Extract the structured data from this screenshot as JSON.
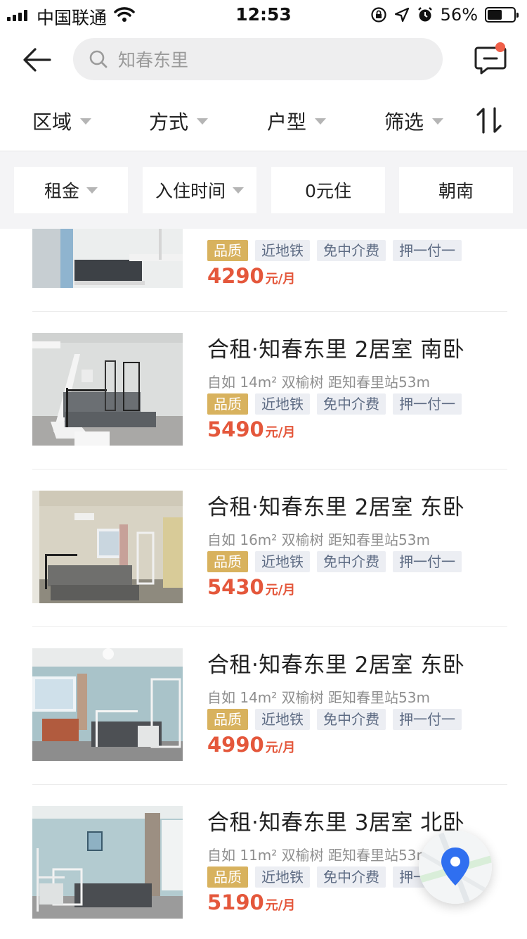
{
  "status_bar": {
    "carrier": "中国联通",
    "time": "12:53",
    "battery_percent": "56%",
    "battery_level": 0.56
  },
  "nav": {
    "search_placeholder": "知春东里",
    "has_unread_message": true
  },
  "filters": [
    {
      "label": "区域"
    },
    {
      "label": "方式"
    },
    {
      "label": "户型"
    },
    {
      "label": "筛选"
    }
  ],
  "quick_filters": [
    {
      "label": "租金",
      "has_dropdown": true
    },
    {
      "label": "入住时间",
      "has_dropdown": true
    },
    {
      "label": "0元住",
      "has_dropdown": false
    },
    {
      "label": "朝南",
      "has_dropdown": false
    }
  ],
  "listings": [
    {
      "title": "",
      "meta": "",
      "tags": [
        "品质",
        "近地铁",
        "免中介费",
        "押一付一"
      ],
      "price": "4290",
      "price_unit": "元/月"
    },
    {
      "title": "合租·知春东里 2居室 南卧",
      "meta": "自如   14m² 双榆树 距知春里站53m",
      "tags": [
        "品质",
        "近地铁",
        "免中介费",
        "押一付一"
      ],
      "price": "5490",
      "price_unit": "元/月"
    },
    {
      "title": "合租·知春东里 2居室 东卧",
      "meta": "自如   16m² 双榆树 距知春里站53m",
      "tags": [
        "品质",
        "近地铁",
        "免中介费",
        "押一付一"
      ],
      "price": "5430",
      "price_unit": "元/月"
    },
    {
      "title": "合租·知春东里 2居室 东卧",
      "meta": "自如   14m² 双榆树 距知春里站53m",
      "tags": [
        "品质",
        "近地铁",
        "免中介费",
        "押一付一"
      ],
      "price": "4990",
      "price_unit": "元/月"
    },
    {
      "title": "合租·知春东里 3居室 北卧",
      "meta": "自如   11m² 双榆树 距知春里站53m",
      "tags": [
        "品质",
        "近地铁",
        "免中介费",
        "押一付一"
      ],
      "price": "5190",
      "price_unit": "元/月"
    }
  ],
  "colors": {
    "price": "#e4573b",
    "quality_tag": "#d8b25e",
    "tag_bg": "#eceef3",
    "map_pin": "#2f6ff0",
    "notify_dot": "#f06049"
  },
  "icons": [
    "back-arrow-icon",
    "search-icon",
    "message-icon",
    "sort-icon",
    "map-pin-icon"
  ]
}
